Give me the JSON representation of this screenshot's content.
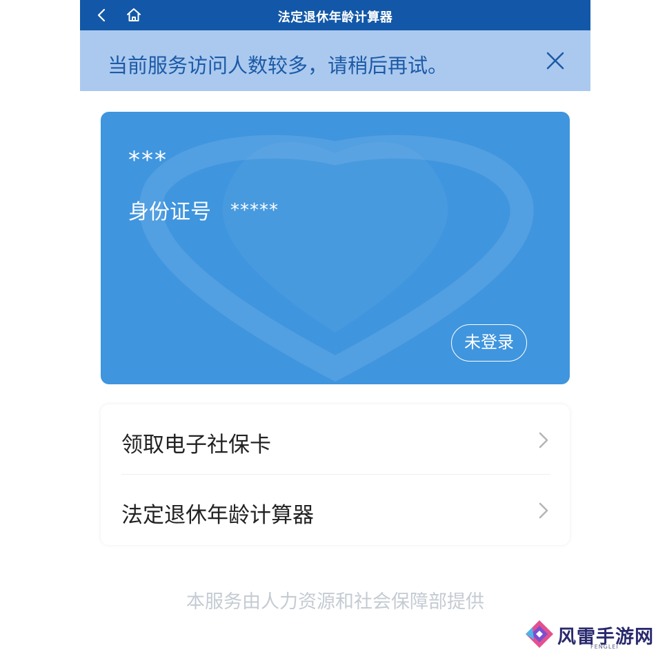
{
  "topbar": {
    "title": "法定退休年龄计算器",
    "back_icon": "chevron-left-icon",
    "home_icon": "home-icon",
    "bg_color": "#1358a8"
  },
  "notice": {
    "message": "当前服务访问人数较多，请稍后再试。",
    "close_icon": "close-icon",
    "bg_color": "#abc9ef"
  },
  "card": {
    "name": "***",
    "id_label": "身份证号",
    "id_value": "*****",
    "login_button": "未登录",
    "bg_color": "#3f95de",
    "watermark_icon": "shield-heart-icon"
  },
  "menu": {
    "items": [
      {
        "label": "领取电子社保卡",
        "icon": "chevron-right-icon"
      },
      {
        "label": "法定退休年龄计算器",
        "icon": "chevron-right-icon"
      }
    ]
  },
  "footer": {
    "text": "本服务由人力资源和社会保障部提供"
  },
  "watermark_logo": {
    "text": "风雷手游网",
    "sub": "FENGLEI"
  }
}
